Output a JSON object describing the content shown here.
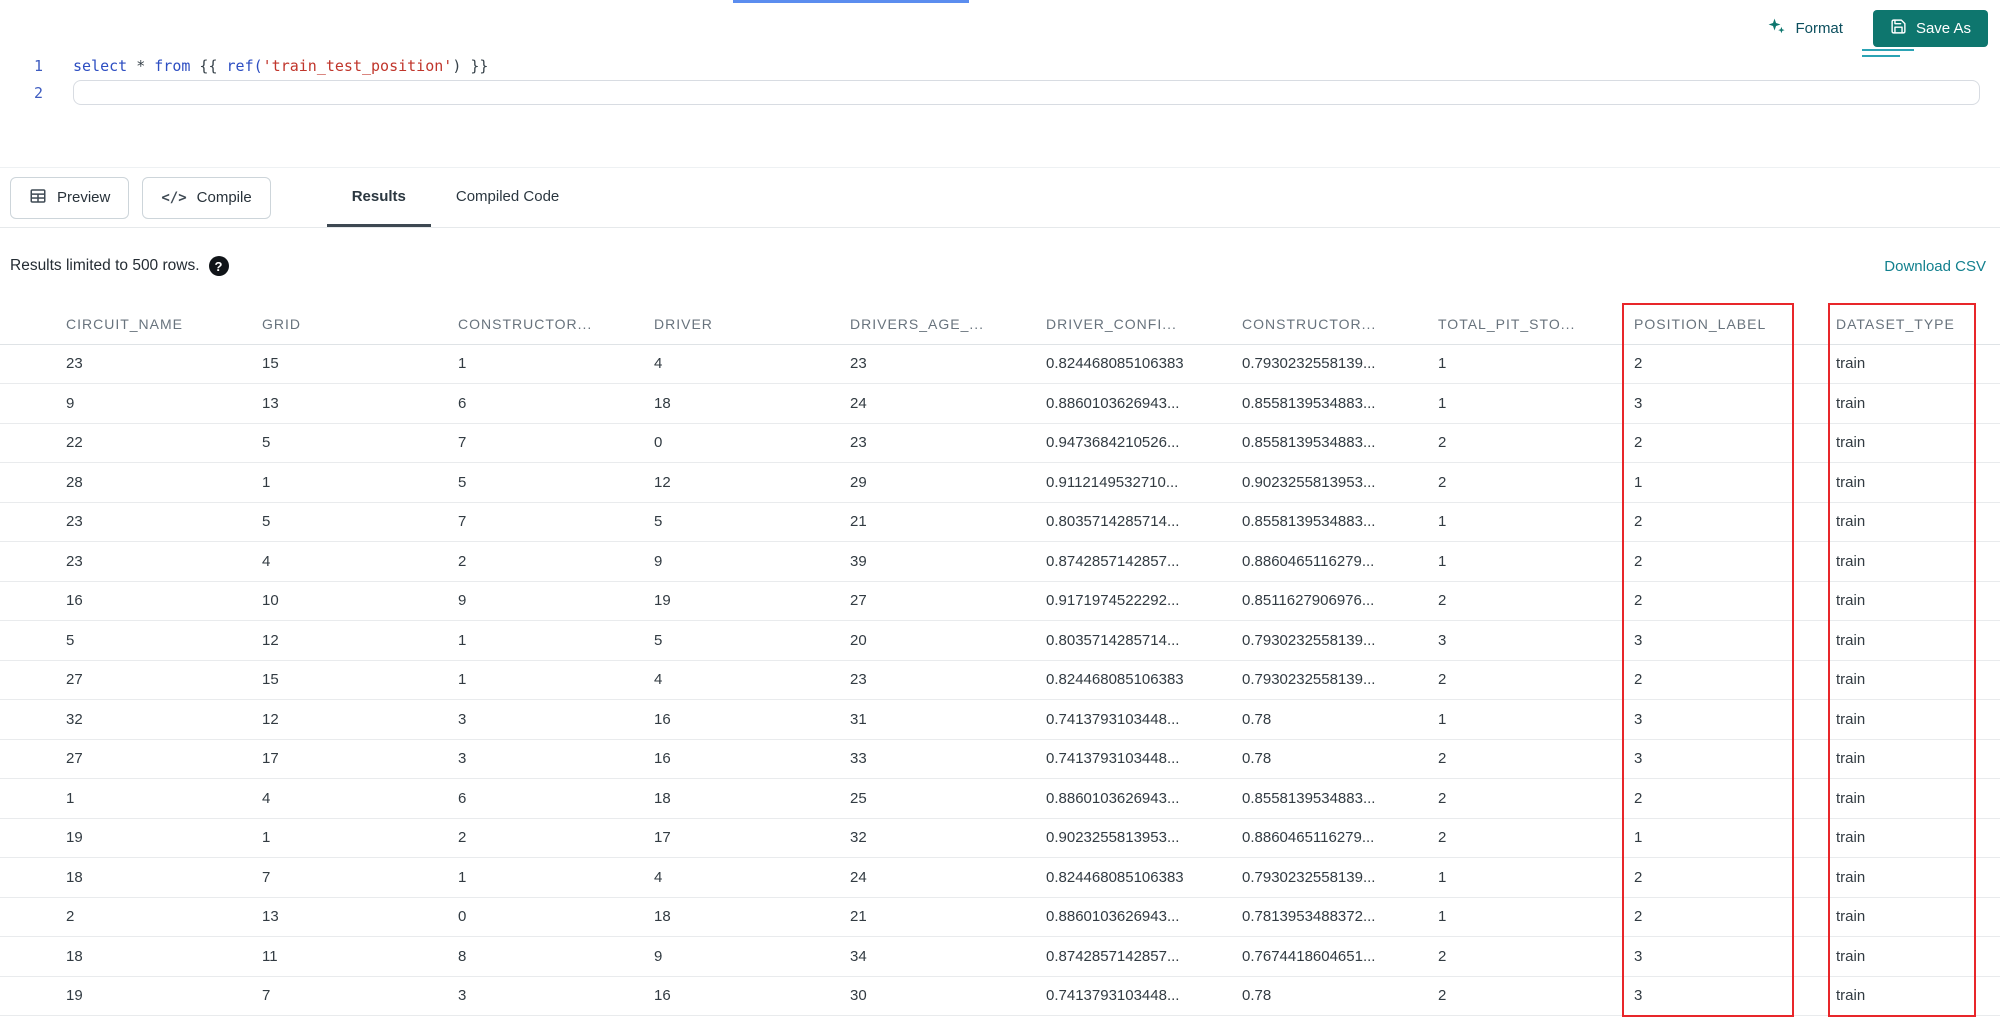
{
  "editor": {
    "line_numbers": [
      "1",
      "2"
    ],
    "tokens": [
      {
        "t": "select",
        "c": "kw"
      },
      {
        "t": " ",
        "c": "plain"
      },
      {
        "t": "*",
        "c": "op"
      },
      {
        "t": " ",
        "c": "plain"
      },
      {
        "t": "from",
        "c": "kw"
      },
      {
        "t": " {{ ",
        "c": "plain"
      },
      {
        "t": "ref(",
        "c": "fn"
      },
      {
        "t": "'train_test_position'",
        "c": "str"
      },
      {
        "t": ")",
        "c": "plain"
      },
      {
        "t": " }}",
        "c": "plain"
      }
    ]
  },
  "toolbar": {
    "format": "Format",
    "save_as": "Save As"
  },
  "actions": {
    "preview": "Preview",
    "compile": "Compile",
    "compile_glyph": "</>"
  },
  "tabs": [
    {
      "label": "Results",
      "active": true
    },
    {
      "label": "Compiled Code",
      "active": false
    }
  ],
  "results_bar": {
    "message": "Results limited to 500 rows.",
    "help": "?",
    "download": "Download CSV"
  },
  "table": {
    "columns": [
      "CIRCUIT_NAME",
      "GRID",
      "CONSTRUCTOR...",
      "DRIVER",
      "DRIVERS_AGE_...",
      "DRIVER_CONFI...",
      "CONSTRUCTOR...",
      "TOTAL_PIT_STO...",
      "POSITION_LABEL",
      "DATASET_TYPE"
    ],
    "rows": [
      [
        "23",
        "15",
        "1",
        "4",
        "23",
        "0.824468085106383",
        "0.7930232558139...",
        "1",
        "2",
        "train"
      ],
      [
        "9",
        "13",
        "6",
        "18",
        "24",
        "0.8860103626943...",
        "0.8558139534883...",
        "1",
        "3",
        "train"
      ],
      [
        "22",
        "5",
        "7",
        "0",
        "23",
        "0.9473684210526...",
        "0.8558139534883...",
        "2",
        "2",
        "train"
      ],
      [
        "28",
        "1",
        "5",
        "12",
        "29",
        "0.9112149532710...",
        "0.9023255813953...",
        "2",
        "1",
        "train"
      ],
      [
        "23",
        "5",
        "7",
        "5",
        "21",
        "0.8035714285714...",
        "0.8558139534883...",
        "1",
        "2",
        "train"
      ],
      [
        "23",
        "4",
        "2",
        "9",
        "39",
        "0.8742857142857...",
        "0.8860465116279...",
        "1",
        "2",
        "train"
      ],
      [
        "16",
        "10",
        "9",
        "19",
        "27",
        "0.9171974522292...",
        "0.8511627906976...",
        "2",
        "2",
        "train"
      ],
      [
        "5",
        "12",
        "1",
        "5",
        "20",
        "0.8035714285714...",
        "0.7930232558139...",
        "3",
        "3",
        "train"
      ],
      [
        "27",
        "15",
        "1",
        "4",
        "23",
        "0.824468085106383",
        "0.7930232558139...",
        "2",
        "2",
        "train"
      ],
      [
        "32",
        "12",
        "3",
        "16",
        "31",
        "0.7413793103448...",
        "0.78",
        "1",
        "3",
        "train"
      ],
      [
        "27",
        "17",
        "3",
        "16",
        "33",
        "0.7413793103448...",
        "0.78",
        "2",
        "3",
        "train"
      ],
      [
        "1",
        "4",
        "6",
        "18",
        "25",
        "0.8860103626943...",
        "0.8558139534883...",
        "2",
        "2",
        "train"
      ],
      [
        "19",
        "1",
        "2",
        "17",
        "32",
        "0.9023255813953...",
        "0.8860465116279...",
        "2",
        "1",
        "train"
      ],
      [
        "18",
        "7",
        "1",
        "4",
        "24",
        "0.824468085106383",
        "0.7930232558139...",
        "1",
        "2",
        "train"
      ],
      [
        "2",
        "13",
        "0",
        "18",
        "21",
        "0.8860103626943...",
        "0.7813953488372...",
        "1",
        "2",
        "train"
      ],
      [
        "18",
        "11",
        "8",
        "9",
        "34",
        "0.8742857142857...",
        "0.7674418604651...",
        "2",
        "3",
        "train"
      ],
      [
        "19",
        "7",
        "3",
        "16",
        "30",
        "0.7413793103448...",
        "0.78",
        "2",
        "3",
        "train"
      ]
    ],
    "highlighted_columns": [
      "POSITION_LABEL",
      "DATASET_TYPE"
    ]
  },
  "colors": {
    "accent": "#0e766e",
    "link": "#12808e",
    "highlight": "#e8262a"
  }
}
